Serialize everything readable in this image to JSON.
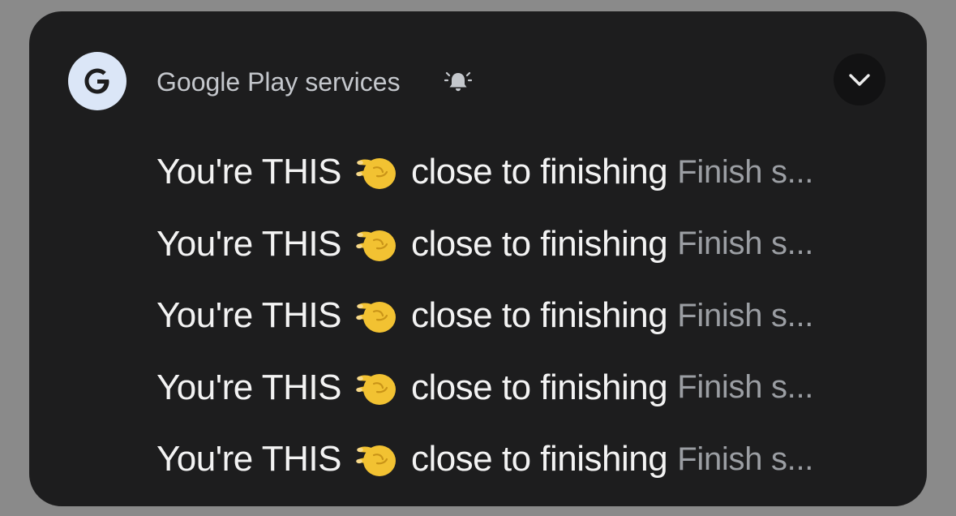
{
  "notification": {
    "app_name": "Google Play services",
    "app_icon": "google-g-icon",
    "bell_icon": "bell-ringing-icon",
    "expand_icon": "chevron-down-icon",
    "accent_color": "#dbe6f7",
    "messages": [
      {
        "title_start": "You're THIS",
        "emoji": "pinching-hand-emoji",
        "title_end": "close to finishing",
        "preview": "Finish s..."
      },
      {
        "title_start": "You're THIS",
        "emoji": "pinching-hand-emoji",
        "title_end": "close to finishing",
        "preview": "Finish s..."
      },
      {
        "title_start": "You're THIS",
        "emoji": "pinching-hand-emoji",
        "title_end": "close to finishing",
        "preview": "Finish s..."
      },
      {
        "title_start": "You're THIS",
        "emoji": "pinching-hand-emoji",
        "title_end": "close to finishing",
        "preview": "Finish s..."
      },
      {
        "title_start": "You're THIS",
        "emoji": "pinching-hand-emoji",
        "title_end": "close to finishing",
        "preview": "Finish s..."
      }
    ]
  }
}
